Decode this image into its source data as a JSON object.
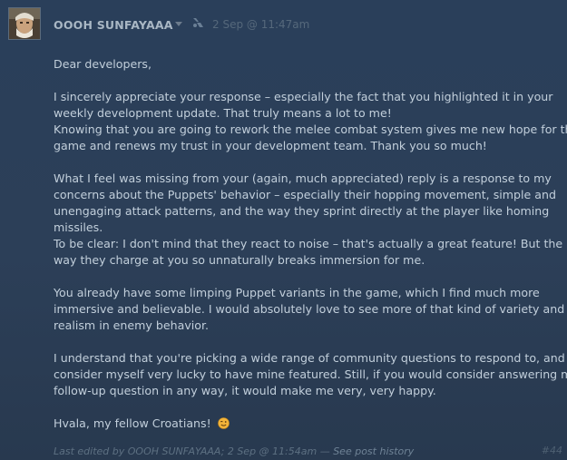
{
  "post": {
    "author": "OOOH SUNFAYAAA",
    "timestamp": "2 Sep @ 11:47am",
    "paragraphs": [
      [
        "Dear developers,"
      ],
      [
        "I sincerely appreciate your response – especially the fact that you highlighted it in your",
        "weekly development update. That truly means a lot to me!",
        "Knowing that you are going to rework the melee combat system gives me new hope for the",
        "game and renews my trust in your development team. Thank you so much!"
      ],
      [
        "What I feel was missing from your (again, much appreciated) reply is a response to my",
        "concerns about the Puppets' behavior – especially their hopping movement, simple and",
        "unengaging attack patterns, and the way they sprint directly at the player like homing",
        "missiles.",
        "To be clear: I don't mind that they react to noise – that's actually a great feature! But the",
        "way they charge at you so unnaturally breaks immersion for me."
      ],
      [
        "You already have some limping Puppet variants in the game, which I find much more",
        "immersive and believable. I would absolutely love to see more of that kind of variety and",
        "realism in enemy behavior."
      ],
      [
        "I understand that you're picking a wide range of community questions to respond to, and I",
        "consider myself very lucky to have mine featured. Still, if you would consider answering my",
        "follow-up question in any way, it would make me very, very happy."
      ],
      [
        "Hvala, my fellow Croatians!"
      ]
    ],
    "edit_note_prefix": "Last edited by OOOH SUNFAYAAA; 2 Sep @ 11:54am — ",
    "edit_history_link": "See post history",
    "post_number": "#44",
    "icons": {
      "author_menu": "chevron-down-icon",
      "developer_response": "dev-comment-icon",
      "closing_emoji": "winking-face-emoji"
    },
    "colors": {
      "background": "#2b3e57",
      "text": "#c2cfdb",
      "author": "#a9b7c4",
      "muted": "#55687b"
    }
  }
}
